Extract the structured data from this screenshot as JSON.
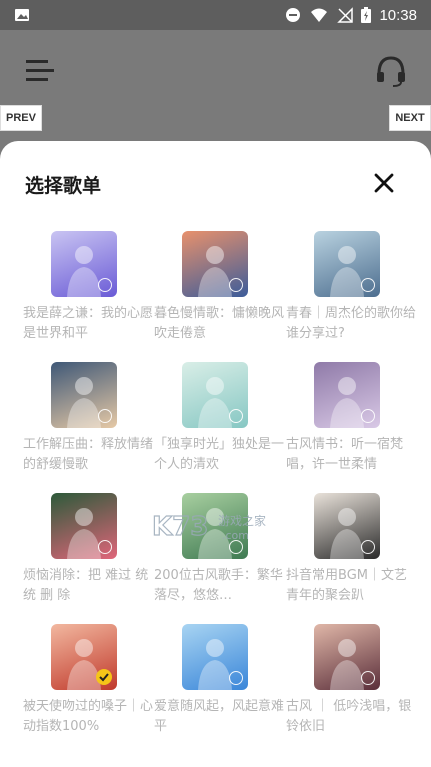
{
  "status_bar": {
    "time": "10:38",
    "icons": [
      "image-icon",
      "do-not-disturb-icon",
      "wifi-icon",
      "no-signal-icon",
      "battery-charging-icon"
    ]
  },
  "header": {
    "icons": [
      "menu-icon",
      "headset-icon"
    ]
  },
  "nav": {
    "prev_label": "PREV",
    "next_label": "NEXT"
  },
  "sheet": {
    "title": "选择歌单",
    "close_icon": "close-icon",
    "accent_color": "#f5c518",
    "playlists": [
      {
        "label": "我是薛之谦：我的心愿是世界和平",
        "selected": false,
        "colors": [
          "#6a5bd6",
          "#c9c4f2"
        ]
      },
      {
        "label": "暮色慢情歌：慵懒晚风吹走倦意",
        "selected": false,
        "colors": [
          "#3c5c9a",
          "#e8916c"
        ]
      },
      {
        "label": "青春｜周杰伦的歌你给谁分享过?",
        "selected": false,
        "colors": [
          "#4d6e8f",
          "#b9d2e0"
        ]
      },
      {
        "label": "工作解压曲：释放情绪的舒缓慢歌",
        "selected": false,
        "colors": [
          "#e6c9a6",
          "#3f5877"
        ]
      },
      {
        "label": "「独享时光」独处是一个人的清欢",
        "selected": false,
        "colors": [
          "#86c7c3",
          "#d9eee7"
        ]
      },
      {
        "label": "古风情书：听一宿梵唱，许一世柔情",
        "selected": false,
        "colors": [
          "#d9c9e6",
          "#8f7aa8"
        ]
      },
      {
        "label": "烦恼消除：把 难过 统 统 删 除",
        "selected": false,
        "colors": [
          "#e0667a",
          "#2d5a3a"
        ]
      },
      {
        "label": "200位古风歌手：繁华落尽，悠悠…",
        "selected": false,
        "colors": [
          "#3f7a52",
          "#a8cfa0"
        ]
      },
      {
        "label": "抖音常用BGM｜文艺青年的聚会趴",
        "selected": false,
        "colors": [
          "#2a2a2a",
          "#e9e2da"
        ]
      },
      {
        "label": "被天使吻过的嗓子｜心动指数100%",
        "selected": true,
        "colors": [
          "#c0392b",
          "#f2b8a0"
        ]
      },
      {
        "label": "爱意随风起，风起意难平",
        "selected": false,
        "colors": [
          "#3a86d9",
          "#a8d4f2"
        ]
      },
      {
        "label": "古风 ｜ 低吟浅唱，银铃依旧",
        "selected": false,
        "colors": [
          "#5a2e3a",
          "#e0b7a8"
        ]
      }
    ]
  },
  "watermark": {
    "text": "K73 游戏之家",
    "sub": ".com"
  }
}
